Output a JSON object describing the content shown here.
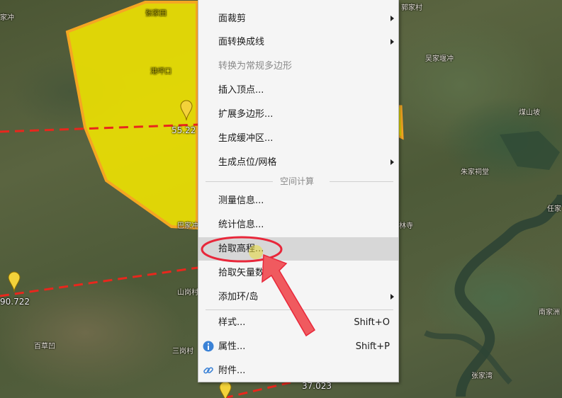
{
  "map": {
    "labels": [
      {
        "text": "家冲"
      },
      {
        "text": "张家田"
      },
      {
        "text": "港坪口"
      },
      {
        "text": "吴家堰冲"
      },
      {
        "text": "煤山坡"
      },
      {
        "text": "朱家祠堂"
      },
      {
        "text": "任家"
      },
      {
        "text": "林寺"
      },
      {
        "text": "巴家冲"
      },
      {
        "text": "山岗村"
      },
      {
        "text": "百草凹"
      },
      {
        "text": "三岗村"
      },
      {
        "text": "南家洲"
      },
      {
        "text": "张家湾"
      },
      {
        "text": "郭家村"
      }
    ],
    "elevations": [
      {
        "text": "55.22"
      },
      {
        "text": "90.722"
      },
      {
        "text": "37.023"
      }
    ]
  },
  "context_menu": {
    "items": [
      {
        "label": "面裁剪",
        "submenu": true
      },
      {
        "label": "面转换成线",
        "submenu": true
      },
      {
        "label": "转换为常规多边形",
        "disabled": true
      },
      {
        "label": "插入顶点..."
      },
      {
        "label": "扩展多边形..."
      },
      {
        "label": "生成缓冲区..."
      },
      {
        "label": "生成点位/网格",
        "submenu": true
      }
    ],
    "section_header": "空间计算",
    "items2": [
      {
        "label": "测量信息..."
      },
      {
        "label": "统计信息..."
      },
      {
        "label": "拾取高程...",
        "highlighted": true
      },
      {
        "label": "拾取矢量数"
      },
      {
        "label": "添加环/岛",
        "submenu": true
      }
    ],
    "items3": [
      {
        "label": "样式...",
        "shortcut": "Shift+O"
      },
      {
        "label": "属性...",
        "shortcut": "Shift+P",
        "icon": "info-icon"
      },
      {
        "label": "附件...",
        "icon": "link-icon"
      }
    ]
  },
  "colors": {
    "polygon_fill": "#f2e600",
    "polygon_stroke": "#f5a623",
    "route_line": "#e8271d",
    "annotation_red": "#e8273a",
    "highlight_bg": "#d7d7d7"
  }
}
